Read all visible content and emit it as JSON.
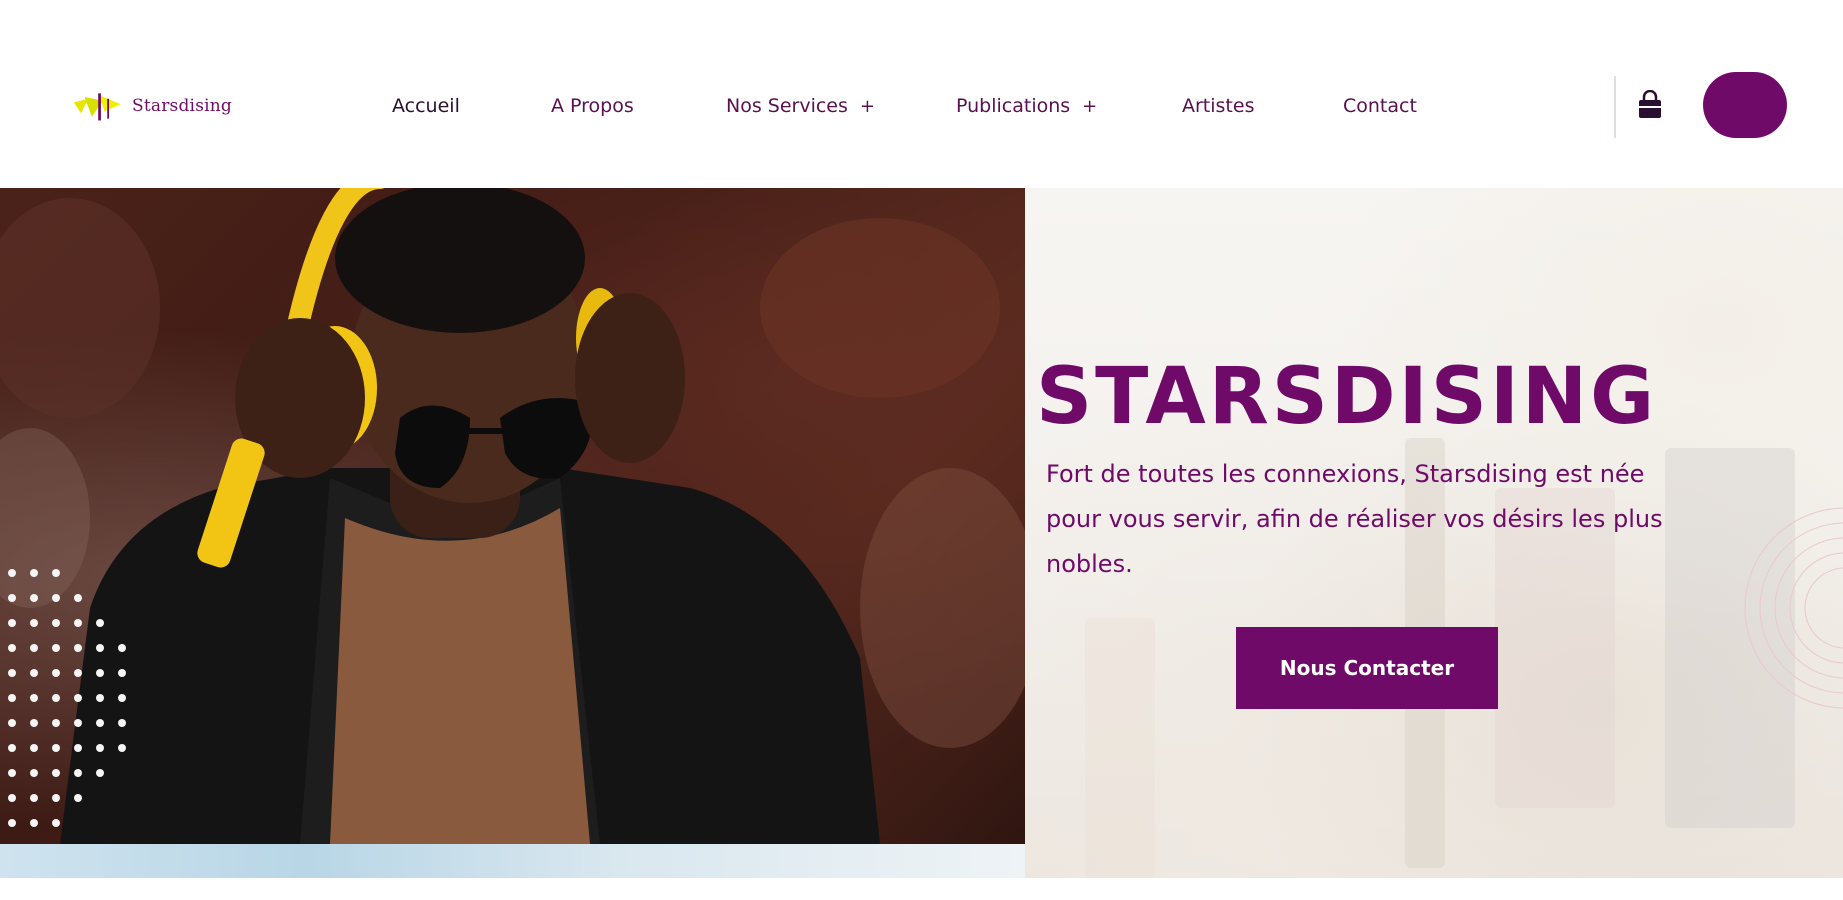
{
  "brand": {
    "name": "Starsdising",
    "accent": "#6f0a68",
    "logo_color": "#e6e600"
  },
  "nav": {
    "items": [
      {
        "label": "Accueil",
        "has_submenu": false
      },
      {
        "label": "A Propos",
        "has_submenu": false
      },
      {
        "label": "Nos Services",
        "has_submenu": true
      },
      {
        "label": "Publications",
        "has_submenu": true
      },
      {
        "label": "Artistes",
        "has_submenu": false
      },
      {
        "label": "Contact",
        "has_submenu": false
      }
    ],
    "submenu_symbol": "+",
    "cart_icon": "shopping-bag-icon"
  },
  "hero": {
    "title": "STARSDISING",
    "text": "Fort de toutes les connexions, Starsdising est née pour vous servir, afin de réaliser vos désirs les plus nobles.",
    "cta_label": "Nous Contacter"
  }
}
